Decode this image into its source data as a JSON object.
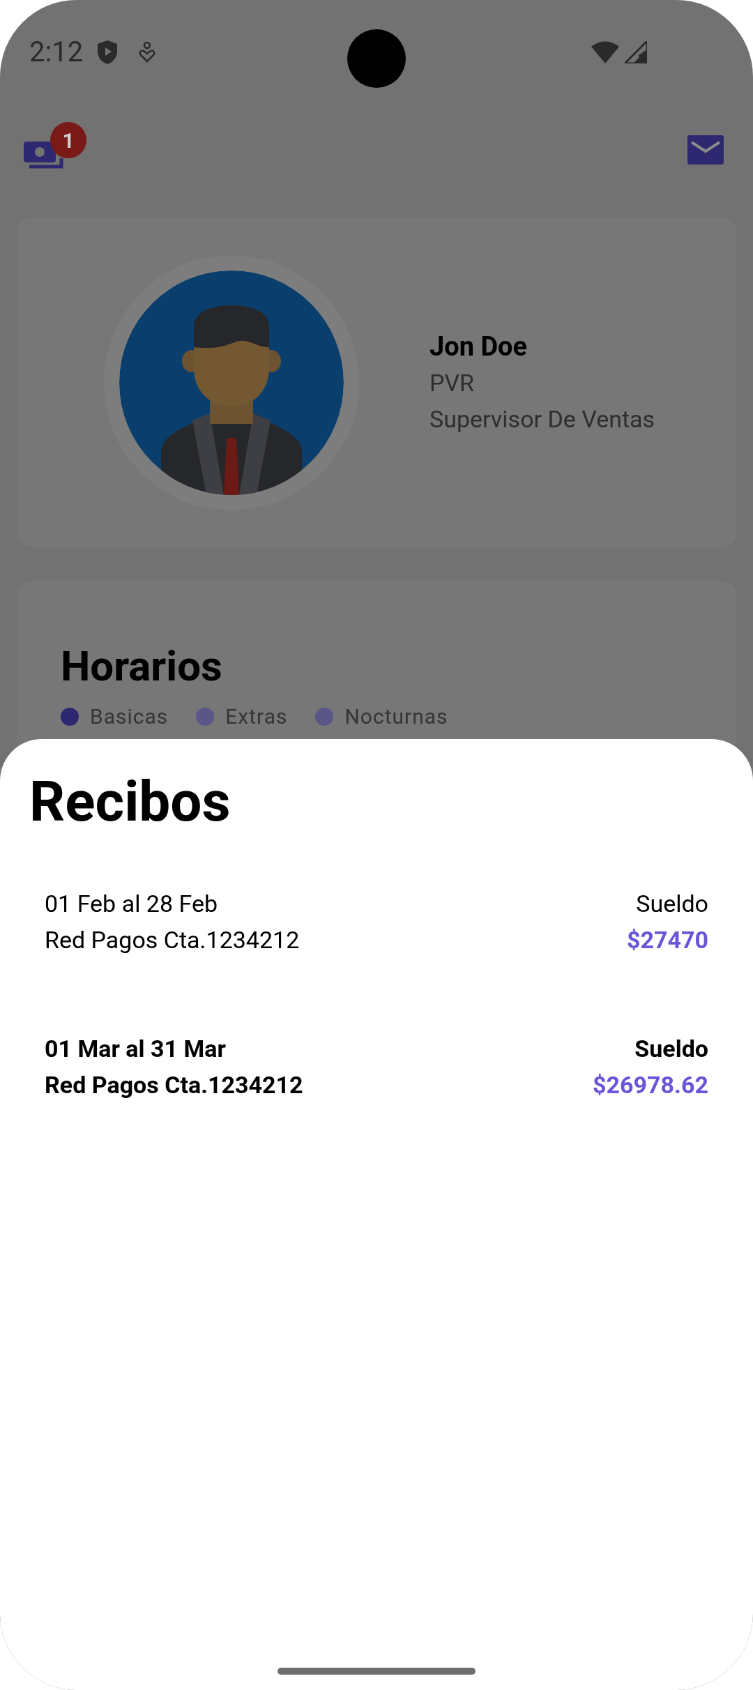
{
  "status_bar": {
    "time": "2:12"
  },
  "app_bar": {
    "notification_count": "1"
  },
  "profile": {
    "name": "Jon Doe",
    "code": "PVR",
    "role": "Supervisor De Ventas"
  },
  "schedule": {
    "title": "Horarios",
    "legend": [
      {
        "label": "Basicas",
        "color": "#2e2870"
      },
      {
        "label": "Extras",
        "color": "#5a5788"
      },
      {
        "label": "Nocturnas",
        "color": "#5a5788"
      }
    ]
  },
  "sheet": {
    "title": "Recibos",
    "receipts": [
      {
        "period": "01 Feb al 28 Feb",
        "account": "Red Pagos Cta.1234212",
        "type": "Sueldo",
        "amount": "$27470",
        "unread": false
      },
      {
        "period": "01 Mar al 31 Mar",
        "account": "Red Pagos Cta.1234212",
        "type": "Sueldo",
        "amount": "$26978.62",
        "unread": true
      }
    ]
  }
}
